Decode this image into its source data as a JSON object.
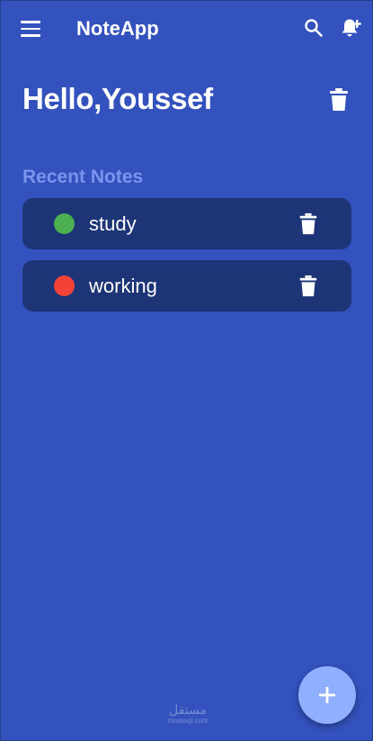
{
  "app": {
    "title": "NoteApp",
    "icons": {
      "menu": "menu-icon",
      "search": "search-icon",
      "add_alert": "bell-plus-icon"
    }
  },
  "header": {
    "greeting": "Hello,Youssef",
    "delete_icon": "trash-icon"
  },
  "notes_section": {
    "title": "Recent Notes",
    "items": [
      {
        "label": "study",
        "dot_color": "#4caf50"
      },
      {
        "label": "working",
        "dot_color": "#f44336"
      }
    ]
  },
  "fab": {
    "icon": "plus-icon"
  },
  "watermark": {
    "arabic": "مستقل",
    "latin": "mostaql.com"
  },
  "colors": {
    "background": "#3352bd",
    "card": "#1d3476",
    "section_title": "#7b95ee",
    "fab": "#8fb0ff"
  }
}
